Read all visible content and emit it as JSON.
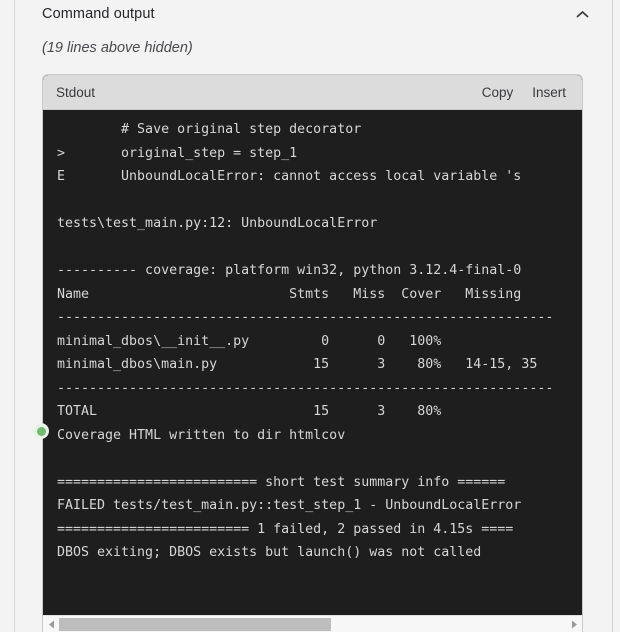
{
  "panel": {
    "title": "Command output",
    "collapse_icon": "chevron-up-icon",
    "hidden_lines_note": "(19 lines above hidden)"
  },
  "code_card": {
    "toolbar": {
      "label": "Stdout",
      "copy_label": "Copy",
      "insert_label": "Insert"
    },
    "colors": {
      "terminal_background": "#1e1e1e",
      "terminal_text": "#d6d6d6",
      "toolbar_background": "#dcdcdc",
      "page_background": "#f3f3f3",
      "status_dot": "#6dbd6d"
    },
    "lines": [
      "        # Save original step decorator",
      ">       original_step = step_1",
      "E       UnboundLocalError: cannot access local variable 's",
      "",
      "tests\\test_main.py:12: UnboundLocalError",
      "",
      "---------- coverage: platform win32, python 3.12.4-final-0",
      "Name                         Stmts   Miss  Cover   Missing",
      "--------------------------------------------------------------",
      "minimal_dbos\\__init__.py         0      0   100%",
      "minimal_dbos\\main.py            15      3    80%   14-15, 35",
      "--------------------------------------------------------------",
      "TOTAL                           15      3    80%",
      "Coverage HTML written to dir htmlcov",
      "",
      "========================= short test summary info ======",
      "FAILED tests/test_main.py::test_step_1 - UnboundLocalError",
      "======================== 1 failed, 2 passed in 4.15s ====",
      "DBOS exiting; DBOS exists but launch() was not called"
    ]
  },
  "scrollbar": {
    "left_arrow_icon": "triangle-left-icon",
    "right_arrow_icon": "triangle-right-icon",
    "orientation": "horizontal"
  },
  "gutter": {
    "status_dot_icon": "green-status-dot-icon"
  }
}
